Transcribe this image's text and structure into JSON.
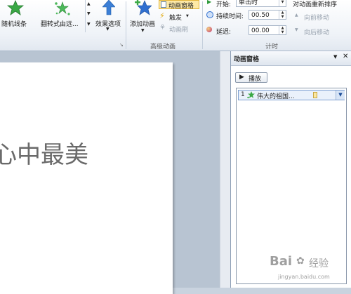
{
  "ribbon": {
    "effects": [
      {
        "label": "随机线条",
        "icon": "star-icon"
      },
      {
        "label": "翻转式由远...",
        "icon": "swirl-star-icon"
      }
    ],
    "effect_options_label": "效果选项",
    "add_animation_label": "添加动画",
    "animation_pane_label": "动画窗格",
    "trigger_label": "触发",
    "animation_painter_label": "动画刷",
    "advanced_group_label": "高级动画",
    "start_label": "开始:",
    "start_value": "单击时",
    "duration_label": "持续时间:",
    "duration_value": "00.50",
    "delay_label": "延迟:",
    "delay_value": "00.00",
    "timing_group_label": "计时",
    "reorder_label": "对动画重新排序",
    "move_earlier_label": "向前移动",
    "move_later_label": "向后移动",
    "colors": {
      "accent": "#f5c400",
      "pane_border": "#7d9fd0"
    }
  },
  "slide": {
    "text": "心中最美"
  },
  "animation_pane": {
    "title": "动画窗格",
    "play_label": "播放",
    "items": [
      {
        "index": "1",
        "name": "伟大的祖国...",
        "icon": "animation-effect-icon"
      }
    ]
  },
  "watermark": {
    "brand": "Bai",
    "brand2": "经验",
    "url": "jingyan.baidu.com"
  }
}
